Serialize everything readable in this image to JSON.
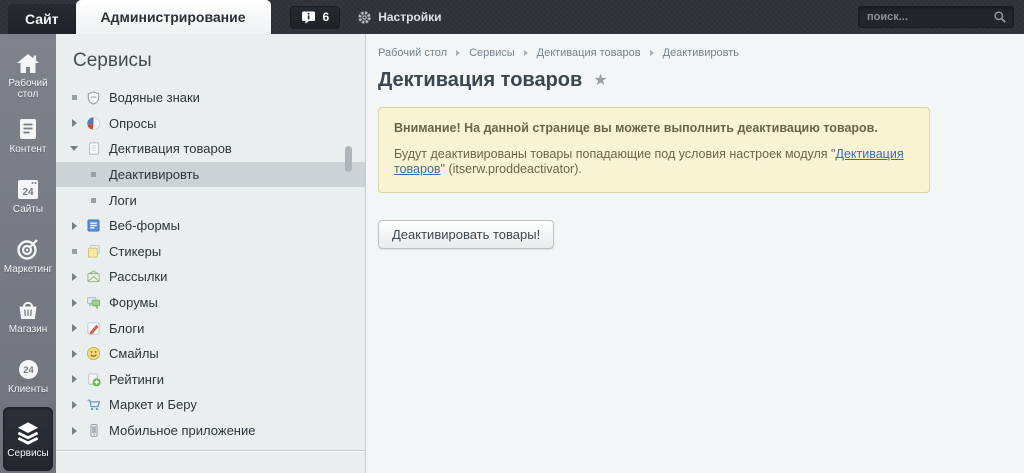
{
  "topbar": {
    "site_tab": "Сайт",
    "admin_tab": "Администрирование",
    "notification_count": "6",
    "settings_label": "Настройки",
    "search_placeholder": "поиск..."
  },
  "rail": {
    "items": [
      {
        "label": "Рабочий стол"
      },
      {
        "label": "Контент"
      },
      {
        "label": "Сайты"
      },
      {
        "label": "Маркетинг"
      },
      {
        "label": "Магазин"
      },
      {
        "label": "Клиенты"
      },
      {
        "label": "Сервисы"
      }
    ]
  },
  "menu": {
    "title": "Сервисы",
    "items": [
      {
        "label": "Водяные знаки"
      },
      {
        "label": "Опросы"
      },
      {
        "label": "Дективация товаров"
      },
      {
        "label": "Деактивировть"
      },
      {
        "label": "Логи"
      },
      {
        "label": "Веб-формы"
      },
      {
        "label": "Стикеры"
      },
      {
        "label": "Рассылки"
      },
      {
        "label": "Форумы"
      },
      {
        "label": "Блоги"
      },
      {
        "label": "Смайлы"
      },
      {
        "label": "Рейтинги"
      },
      {
        "label": "Маркет и Беру"
      },
      {
        "label": "Мобильное приложение"
      }
    ]
  },
  "content": {
    "breadcrumb": [
      "Рабочий стол",
      "Сервисы",
      "Дективация товаров",
      "Деактивировть"
    ],
    "title": "Дективация товаров",
    "favorite_icon": "★",
    "notice": {
      "line1": "Внимание! На данной странице вы можете выполнить деактивацию товаров.",
      "line2_before": "Будут деактивированы товары попадающие под условия настроек модуля \"",
      "line2_link": "Дективация товаров",
      "line2_after": "\" (itserw.proddeactivator)."
    },
    "button_label": "Деактивировать товары!"
  },
  "colors": {
    "topbar_bg": "#2f343a",
    "rail_bg": "#777c84",
    "menu_bg": "#e9eeef",
    "content_bg": "#f2f6f6",
    "selected_row": "#cbd3d5",
    "notice_bg": "#f8f3d3",
    "notice_border": "#dbd4a4",
    "notice_text": "#6e6545",
    "link": "#3e6da5"
  }
}
